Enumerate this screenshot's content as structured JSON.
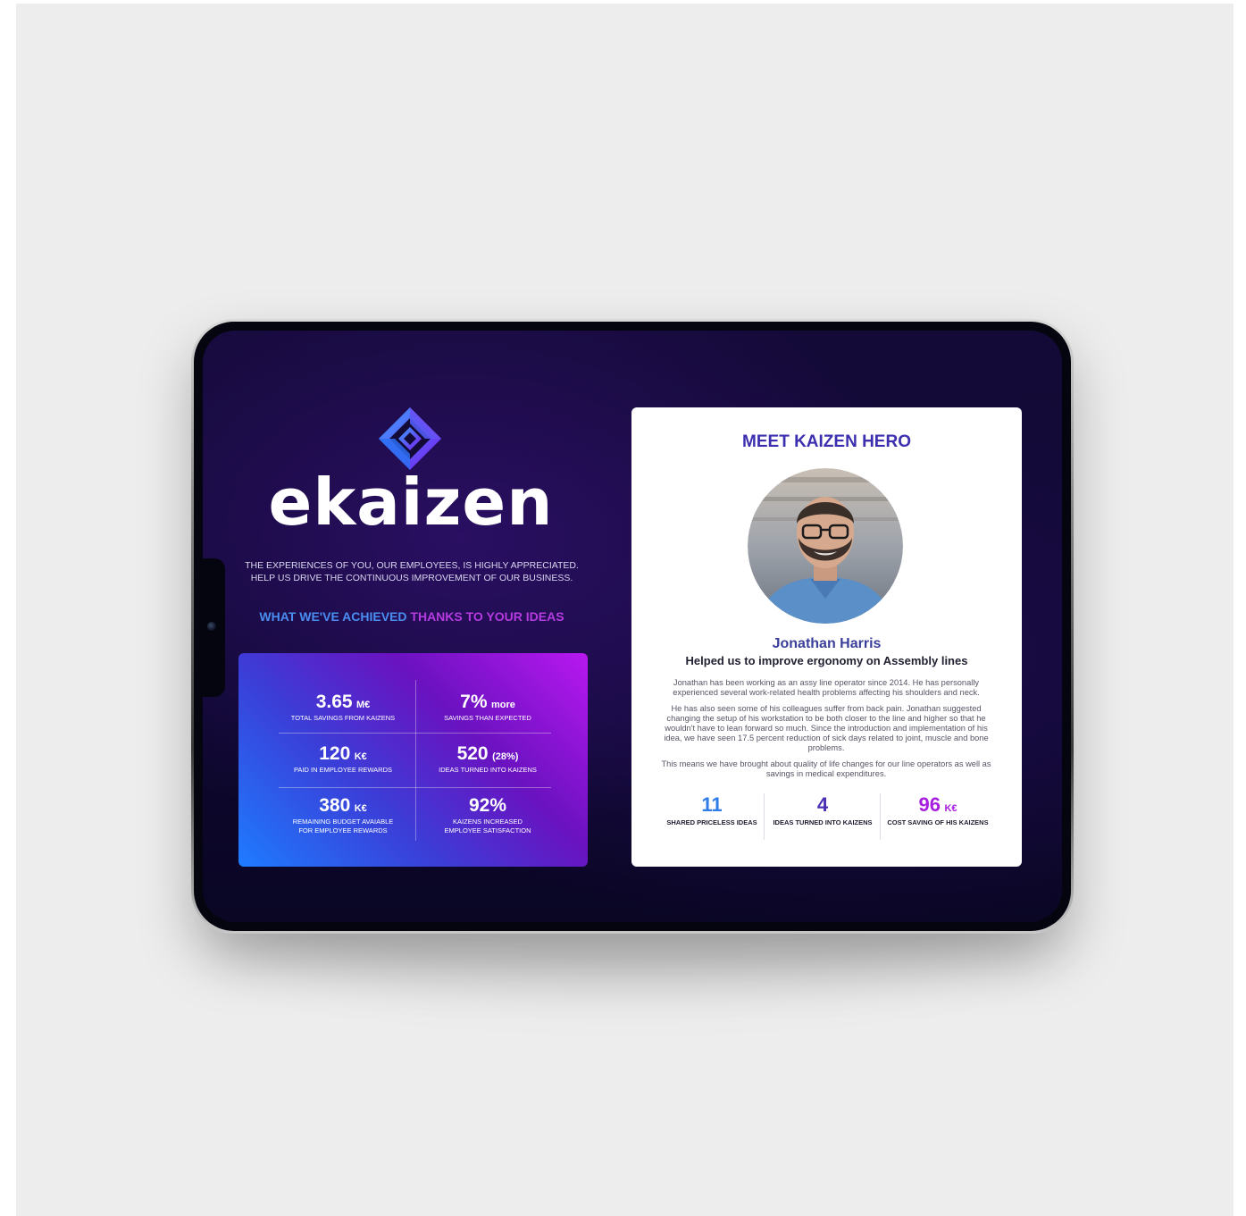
{
  "brand": {
    "name": "ekaizen",
    "tagline_line1": "THE EXPERIENCES OF YOU, OUR EMPLOYEES, IS HIGHLY APPRECIATED.",
    "tagline_line2": "HELP US DRIVE THE CONTINUOUS IMPROVEMENT OF OUR BUSINESS."
  },
  "achieved": {
    "part1": "WHAT WE'VE ACHIEVED ",
    "part2": "THANKS TO YOUR IDEAS"
  },
  "stats": [
    {
      "value": "3.65",
      "unit": "M€",
      "label": "TOTAL SAVINGS FROM KAIZENS"
    },
    {
      "value": "7%",
      "unit": "more",
      "label": "SAVINGS THAN EXPECTED"
    },
    {
      "value": "120",
      "unit": "K€",
      "label": "PAID IN EMPLOYEE REWARDS"
    },
    {
      "value": "520",
      "unit": "(28%)",
      "label": "IDEAS TURNED INTO KAIZENS"
    },
    {
      "value": "380",
      "unit": "K€",
      "label_line1": "REMAINING BUDGET AVAIABLE",
      "label_line2": "FOR EMPLOYEE REWARDS"
    },
    {
      "value": "92%",
      "unit": "",
      "label_line1": "KAIZENS INCREASED",
      "label_line2": "EMPLOYEE SATISFACTION"
    }
  ],
  "hero": {
    "title": "MEET KAIZEN HERO",
    "name": "Jonathan Harris",
    "subtitle": "Helped us to improve ergonomy on Assembly lines",
    "paragraphs": [
      "Jonathan has been working as an assy line operator since 2014. He has personally experienced several work-related health problems affecting his shoulders and neck.",
      "He has also seen some of his colleagues suffer from back pain. Jonathan suggested changing the setup of his workstation to be both closer to the line and higher so that he wouldn't have to lean forward so much. Since the introduction and implementation of his idea, we have seen 17.5 percent reduction of sick days related to joint, muscle and bone problems.",
      "This means we have brought about quality of life changes for our line operators as well as savings in medical expenditures."
    ],
    "stats": [
      {
        "value": "11",
        "unit": "",
        "label": "SHARED PRICELESS IDEAS",
        "color": "#2f7be8"
      },
      {
        "value": "4",
        "unit": "",
        "label": "IDEAS TURNED INTO KAIZENS",
        "color": "#4a2fb5"
      },
      {
        "value": "96",
        "unit": "K€",
        "label": "COST SAVING OF HIS KAIZENS",
        "color": "#a81ee0"
      }
    ]
  },
  "colors": {
    "screen_bg": "#120a34",
    "accent_blue": "#1e7cff",
    "accent_purple": "#b818f0",
    "hero_title": "#3b2fb0"
  },
  "icons": {
    "logo": "ekaizen-logo-icon",
    "avatar": "hero-avatar"
  }
}
